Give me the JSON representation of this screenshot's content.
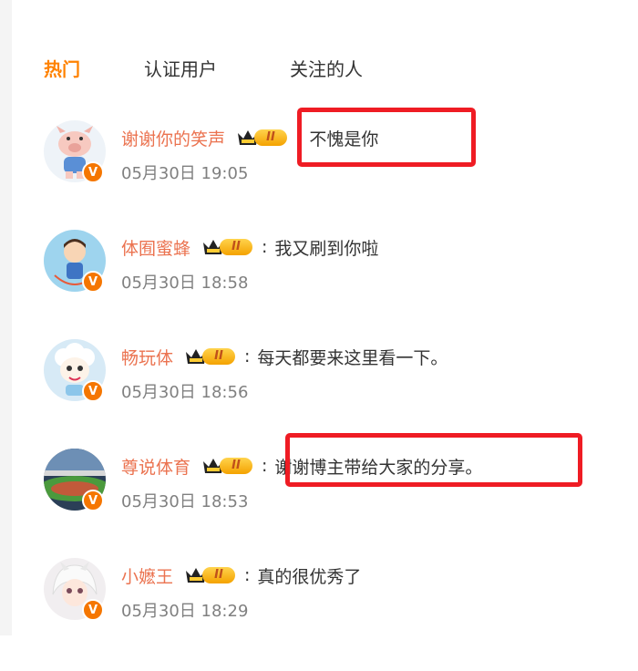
{
  "tabs": [
    "热门",
    "认证用户",
    "关注的人"
  ],
  "vip_level": "II",
  "verified_mark": "V",
  "colors": {
    "accent": "#ff8200",
    "username": "#eb7350",
    "highlight": "#ef1c24"
  },
  "comments": [
    {
      "user": "谢谢你的笑声",
      "text": "不愧是你",
      "time": "05月30日 19:05",
      "avatar": "pig-avatar"
    },
    {
      "user": "体囿蜜蜂",
      "text": "我又刷到你啦",
      "time": "05月30日 18:58",
      "avatar": "boy-jumprope-avatar"
    },
    {
      "user": "畅玩体",
      "text": "每天都要来这里看一下。",
      "time": "05月30日 18:56",
      "avatar": "sheep-avatar"
    },
    {
      "user": "尊说体育",
      "text": "谢谢博主带给大家的分享。",
      "time": "05月30日 18:53",
      "avatar": "stadium-avatar"
    },
    {
      "user": "小嬷王",
      "text": "真的很优秀了",
      "time": "05月30日 18:29",
      "avatar": "anime-girl-avatar"
    }
  ]
}
